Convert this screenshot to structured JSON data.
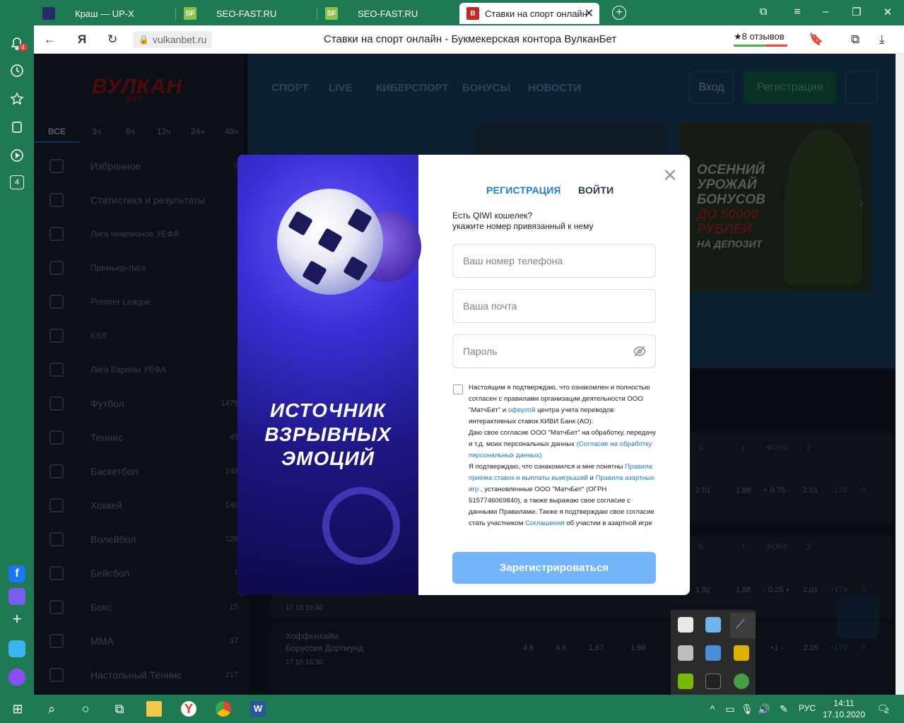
{
  "browser": {
    "tabs": [
      {
        "label": "Краш — UP-X",
        "favicon": "up-x"
      },
      {
        "label": "SEO-FAST.RU",
        "favicon": "SF"
      },
      {
        "label": "SEO-FAST.RU",
        "favicon": "SF"
      },
      {
        "label": "Ставки на спорт онлайн",
        "favicon": "B",
        "active": true
      }
    ],
    "url": "vulkanbet.ru",
    "page_title": "Ставки на спорт онлайн - Букмекерская контора ВулканБет",
    "reviews": "★8 отзывов",
    "notification_badge": "4",
    "sidebar_counter": "4",
    "accent_color": "#1f7a53"
  },
  "site": {
    "logo_main": "ВУЛКАН",
    "logo_sub": "БЕТ",
    "top_nav": [
      "СПОРТ",
      "LIVE",
      "КИБЕРСПОРТ",
      "БОНУСЫ",
      "НОВОСТИ"
    ],
    "login_label": "Вход",
    "register_label": "Регистрация",
    "time_filters": [
      "ВСЕ",
      "3ч",
      "6ч",
      "12ч",
      "24ч",
      "48ч"
    ],
    "nav_items": [
      {
        "label": "Избранное",
        "count": "0"
      },
      {
        "label": "Статистика и результаты",
        "count": ""
      },
      {
        "label": "Лига чемпионов УЕФА",
        "count": ""
      },
      {
        "label": "Премьер-лига",
        "count": ""
      },
      {
        "label": "Premier League",
        "count": ""
      },
      {
        "label": "КХЛ",
        "count": ""
      },
      {
        "label": "Лига Европы УЕФА",
        "count": ""
      },
      {
        "label": "Футбол",
        "count": "1475"
      },
      {
        "label": "Теннис",
        "count": "45"
      },
      {
        "label": "Баскетбол",
        "count": "248"
      },
      {
        "label": "Хоккей",
        "count": "140"
      },
      {
        "label": "Волейбол",
        "count": "126"
      },
      {
        "label": "Бейсбол",
        "count": "7"
      },
      {
        "label": "Бокс",
        "count": "15"
      },
      {
        "label": "MMA",
        "count": "37"
      },
      {
        "label": "Настольный Теннис",
        "count": "217"
      }
    ],
    "promo": {
      "line1": "ОСЕННИЙ",
      "line2": "УРОЖАЙ",
      "line3": "БОНУСОВ",
      "line4": "ДО 50000",
      "line5": "РУБЛЕЙ",
      "line6": "НА ДЕПОЗИТ"
    },
    "odds_headers": [
      "Б",
      "1",
      "ФОРА",
      "2"
    ],
    "rows": [
      {
        "odds": [
          "2.01",
          "1.88",
          "+ 0.75 -",
          "2.01",
          "+178"
        ]
      },
      {
        "odds": [
          "1.92",
          "1.88",
          "- 0.25 +",
          "2.01",
          "+179"
        ],
        "time": "17.10 16:30"
      },
      {
        "team1": "Хоффенхайм",
        "team2": "Боруссия Дортмунд",
        "odds": [
          "4.6",
          "4.6",
          "1.67",
          "1.89",
          "+1 -",
          "2.05",
          "+179"
        ],
        "time": "17.10 16:30"
      }
    ]
  },
  "modal": {
    "slogan_line1": "ИСТОЧНИК",
    "slogan_line2": "ВЗРЫВНЫХ",
    "slogan_line3": "ЭМОЦИЙ",
    "tab_register": "РЕГИСТРАЦИЯ",
    "tab_login": "ВОЙТИ",
    "qiwi_line1": "Есть QIWI кошелек?",
    "qiwi_line2": "укажите номер привязанный к нему",
    "phone_placeholder": "Ваш номер телефона",
    "email_placeholder": "Ваша почта",
    "password_placeholder": "Пароль",
    "agree_parts": {
      "t1": "Настоящим я подтверждаю, что ознакомлен и полностью согласен с правилами организации деятельности ООО \"МатчБет\" и ",
      "l1": "офертой",
      "t2": " центра учета переводов интерактивных ставок КИВИ Банк (АО).",
      "t3": "Даю свое согласие ООО \"МатчБет\" на обработку, передачу и т.д. моих персональных данных ",
      "l2": "(Согласие на обработку персональных данных)",
      "t4": "Я подтверждаю, что ознакомился и мне понятны ",
      "l3": "Правила приема ставок и выплаты выигрышей",
      "t5": " и ",
      "l4": "Правила азартных игр",
      "t6": " , установленные ООО \"МатчБет\" (ОГРН 5157746069840), а также выражаю свое согласие с данными Правилами. Также я подтверждаю свое согласие стать участником ",
      "l5": "Соглашения",
      "t7": " об участии в азартной игре"
    },
    "submit_label": "Зарегистрироваться"
  },
  "taskbar": {
    "lang": "РУС",
    "time": "14:11",
    "date": "17.10.2020",
    "notif_count": "2"
  }
}
